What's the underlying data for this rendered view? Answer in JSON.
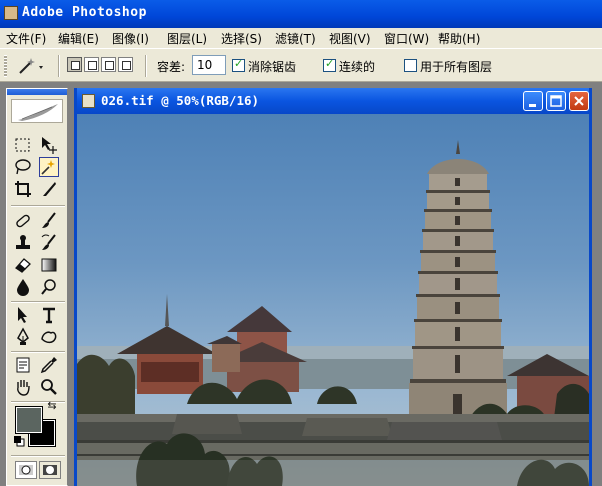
{
  "app": {
    "title": "Adobe Photoshop"
  },
  "menu": [
    "文件(F)",
    "编辑(E)",
    "图像(I)",
    "图层(L)",
    "选择(S)",
    "滤镜(T)",
    "视图(V)",
    "窗口(W)",
    "帮助(H)"
  ],
  "options": {
    "tolerance_label": "容差:",
    "tolerance_value": "10",
    "antialias_label": "消除锯齿",
    "antialias_checked": true,
    "contiguous_label": "连续的",
    "contiguous_checked": true,
    "all_layers_label": "用于所有图层",
    "all_layers_checked": false
  },
  "document": {
    "title": "026.tif @ 50%(RGB/16)"
  },
  "toolbox": {
    "active_tool": "magic-wand-tool",
    "foreground_color": "#5b6560",
    "background_color": "#000000"
  }
}
